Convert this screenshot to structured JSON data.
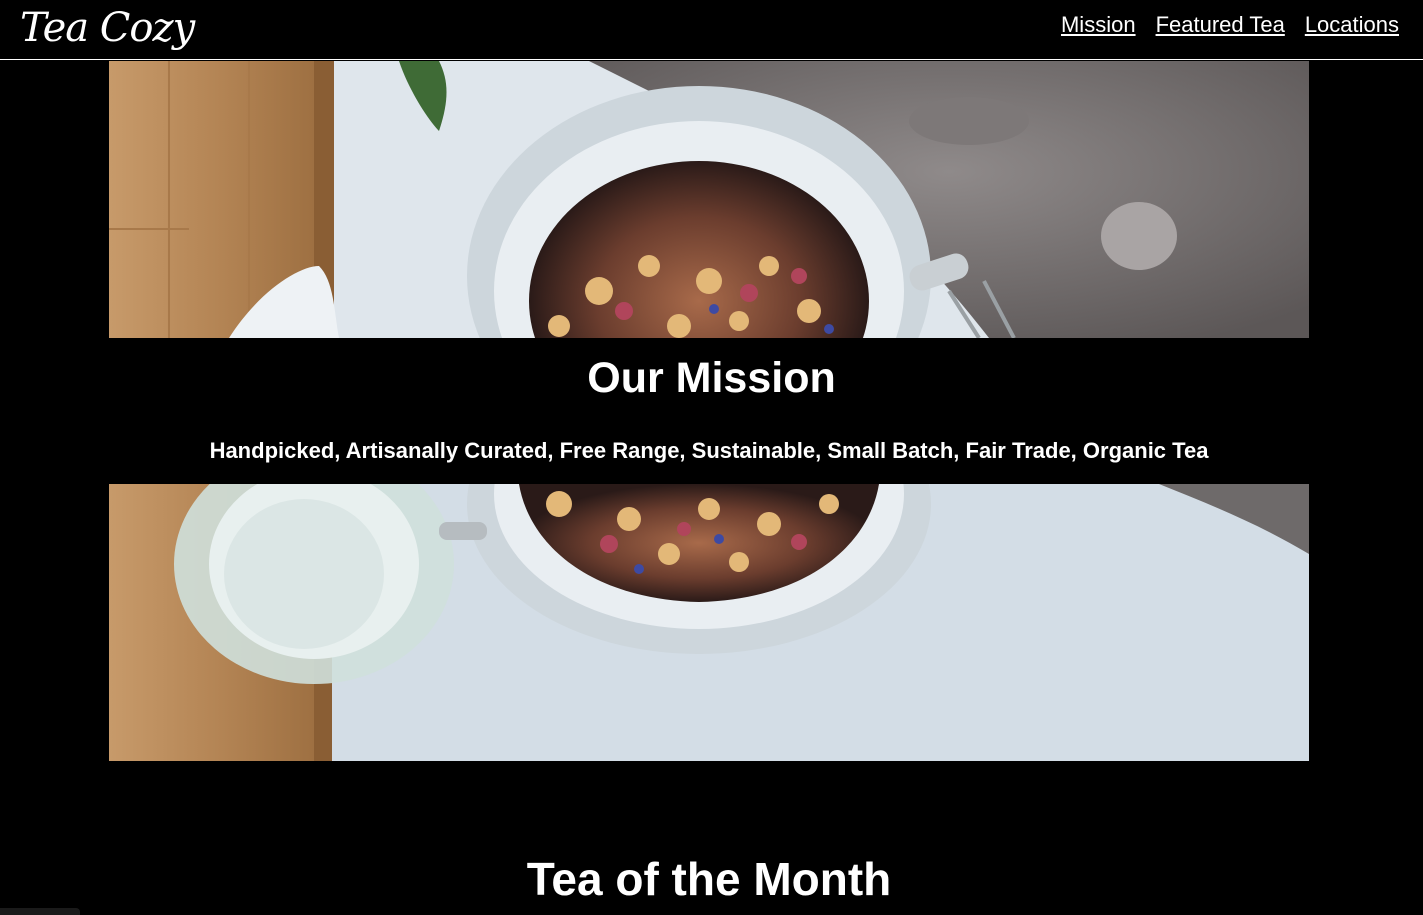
{
  "header": {
    "logo": "Tea Cozy",
    "nav": [
      {
        "label": "Mission"
      },
      {
        "label": "Featured Tea"
      },
      {
        "label": "Locations"
      }
    ]
  },
  "mission": {
    "title": "Our Mission",
    "text": "Handpicked, Artisanally Curated, Free Range, Sustainable, Small Batch, Fair Trade, Organic Tea"
  },
  "featured": {
    "title": "Tea of the Month"
  },
  "colors": {
    "background": "#000000",
    "text": "#ffffff"
  }
}
